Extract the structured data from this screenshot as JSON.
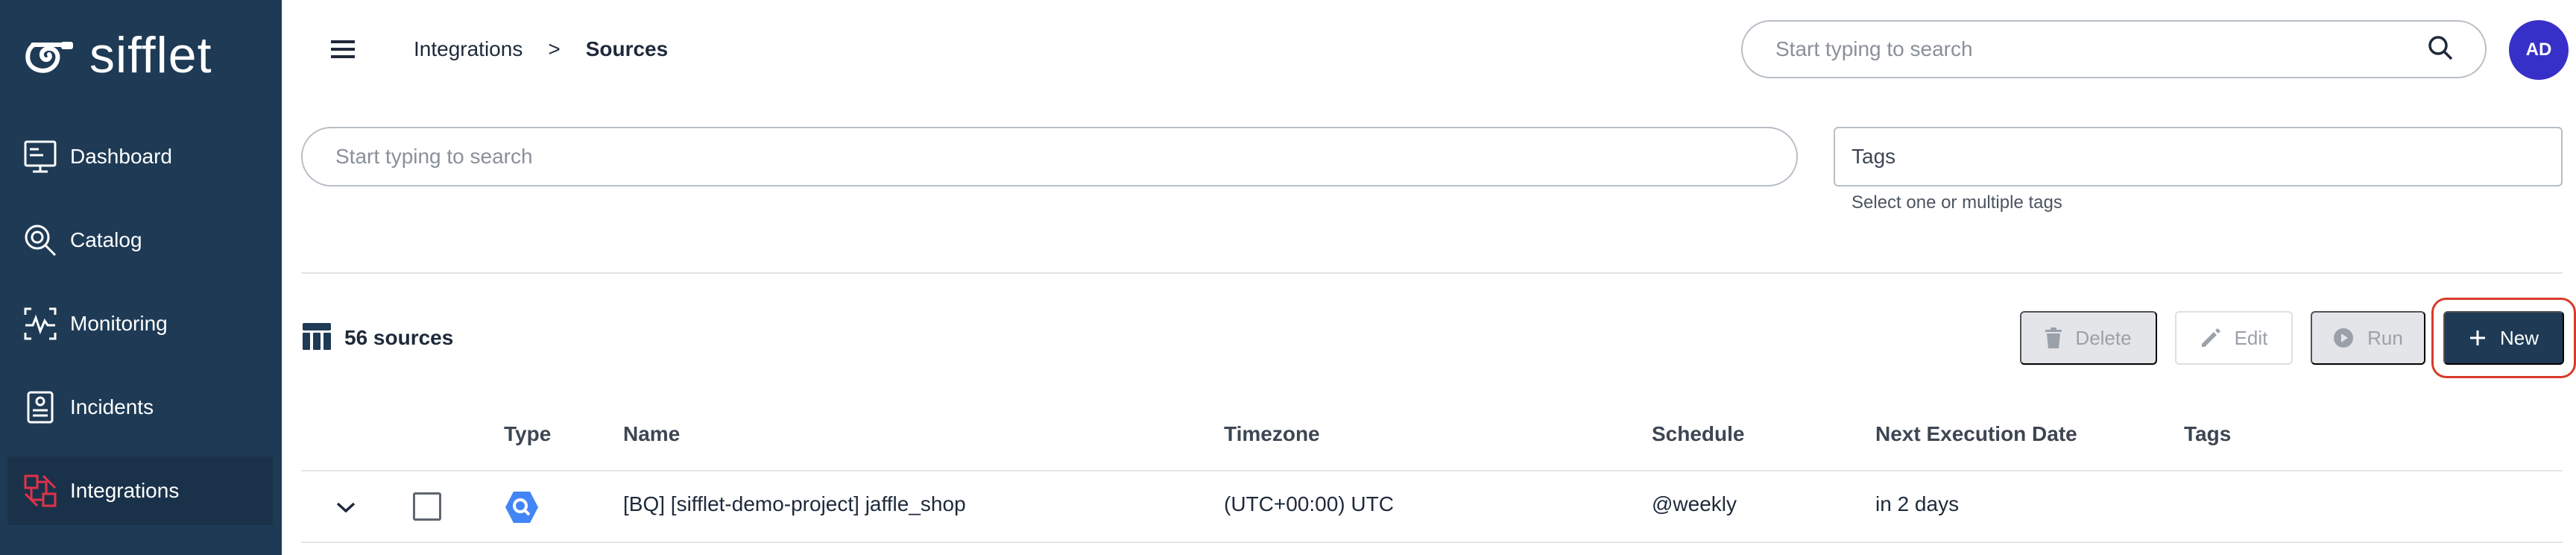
{
  "sidebar": {
    "logo_text": "sifflet",
    "items": [
      {
        "label": "Dashboard",
        "icon": "dashboard-icon"
      },
      {
        "label": "Catalog",
        "icon": "catalog-icon"
      },
      {
        "label": "Monitoring",
        "icon": "monitoring-icon"
      },
      {
        "label": "Incidents",
        "icon": "incidents-icon"
      },
      {
        "label": "Integrations",
        "icon": "integrations-icon",
        "active": true
      }
    ]
  },
  "header": {
    "breadcrumb": [
      "Integrations",
      "Sources"
    ],
    "breadcrumb_separator": ">",
    "search_placeholder": "Start typing to search",
    "avatar_initials": "AD"
  },
  "filters": {
    "search_placeholder": "Start typing to search",
    "tags_label": "Tags",
    "tags_hint": "Select one or multiple tags"
  },
  "toolbar": {
    "count_label": "56 sources",
    "delete_label": "Delete",
    "edit_label": "Edit",
    "run_label": "Run",
    "new_label": "New"
  },
  "table": {
    "columns": [
      "Type",
      "Name",
      "Timezone",
      "Schedule",
      "Next Execution Date",
      "Tags"
    ],
    "rows": [
      {
        "type_icon": "bigquery-icon",
        "name": "[BQ] [sifflet-demo-project] jaffle_shop",
        "timezone": "(UTC+00:00) UTC",
        "schedule": "@weekly",
        "next_execution": "in 2 days",
        "tags": ""
      }
    ]
  },
  "colors": {
    "sidebar_bg": "#1e3a55",
    "accent": "#1e3a55",
    "avatar_bg": "#3730c8",
    "highlight_ring": "#d93a2b",
    "integrations_icon": "#e0334a",
    "bigquery_icon": "#4285f4"
  }
}
